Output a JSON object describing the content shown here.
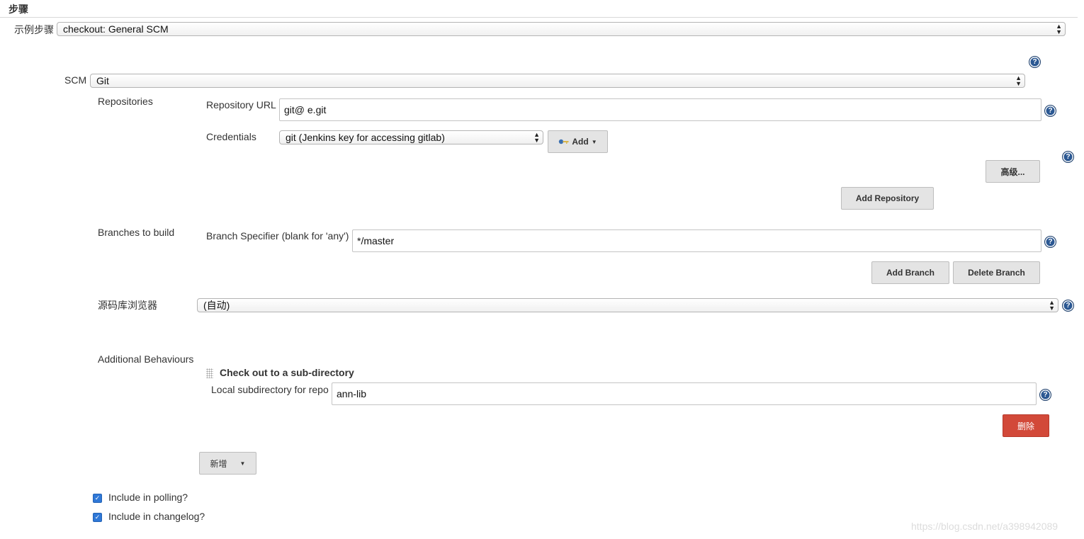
{
  "section": {
    "title": "步骤"
  },
  "sample_step": {
    "label": "示例步骤",
    "value": "checkout: General SCM"
  },
  "scm": {
    "label": "SCM",
    "value": "Git"
  },
  "repositories": {
    "label": "Repositories",
    "url_label": "Repository URL",
    "url_value": "git@                                                            e.git",
    "credentials_label": "Credentials",
    "credentials_value": "git (Jenkins key for accessing gitlab)",
    "add_label": "Add",
    "advanced_label": "高级...",
    "add_repository_label": "Add Repository"
  },
  "branches": {
    "label": "Branches to build",
    "specifier_label": "Branch Specifier (blank for 'any')",
    "specifier_value": "*/master",
    "add_branch_label": "Add Branch",
    "delete_branch_label": "Delete Branch"
  },
  "browser": {
    "label": "源码库浏览器",
    "value": "(自动)"
  },
  "additional_behaviours": {
    "label": "Additional Behaviours",
    "checkout_title": "Check out to a sub-directory",
    "local_subdir_label": "Local subdirectory for repo",
    "local_subdir_value": "ann-lib",
    "delete_label": "删除",
    "add_new_label": "新增"
  },
  "options": {
    "polling_label": "Include in polling?",
    "polling_checked": true,
    "changelog_label": "Include in changelog?",
    "changelog_checked": true
  },
  "help_symbol": "?",
  "watermark": "https://blog.csdn.net/a398942089",
  "icons": {
    "help": "help-icon",
    "key": "key-icon",
    "dropdown": "caret-down-icon",
    "grip": "drag-handle-icon",
    "check": "check-icon"
  },
  "colors": {
    "help_icon": "#2b5893",
    "delete_button": "#d24939",
    "checkbox": "#2f78d7",
    "button_gray": "#e4e4e4"
  }
}
